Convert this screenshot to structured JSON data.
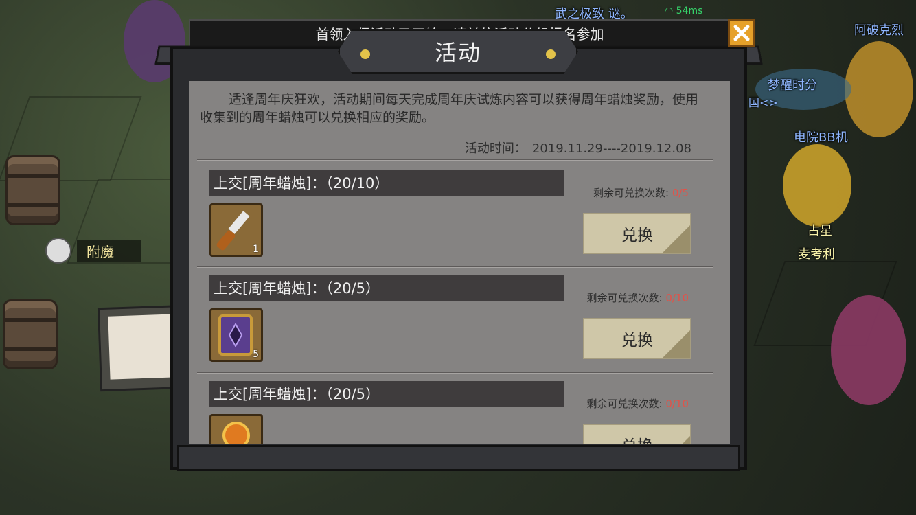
{
  "top_notice": "首领入侵活动已开始，请前往活动分组报名参加",
  "background_labels": {
    "top_center": "武之极致 谜。",
    "top_right": "阿破克烈",
    "right_1": "梦醒时分",
    "right_1_sub": "国<>",
    "right_2": "电院BB机",
    "right_3": "占星",
    "right_4": "麦考利"
  },
  "network": {
    "latency": "54ms"
  },
  "enchant_button": {
    "label": "附魔",
    "icon": "enchant-icon"
  },
  "dialog": {
    "title": "活动",
    "close_icon": "close-x-icon",
    "description": "适逢周年庆狂欢，活动期间每天完成周年庆试炼内容可以获得周年蜡烛奖励，使用收集到的周年蜡烛可以兑换相应的奖励。",
    "time_label": "活动时间：",
    "time_value": "2019.11.29----2019.12.08",
    "items": [
      {
        "header": "上交[周年蜡烛]：（20/10）",
        "remain_label": "剩余可兑换次数:",
        "remain_value": "0/5",
        "button": "兑换",
        "qty": "1",
        "icon": "chisel-icon"
      },
      {
        "header": "上交[周年蜡烛]：（20/5）",
        "remain_label": "剩余可兑换次数:",
        "remain_value": "0/10",
        "button": "兑换",
        "qty": "5",
        "icon": "spellbook-icon"
      },
      {
        "header": "上交[周年蜡烛]：（20/5）",
        "remain_label": "剩余可兑换次数:",
        "remain_value": "0/10",
        "button": "兑换",
        "qty": "",
        "icon": "orb-icon"
      }
    ]
  },
  "colors": {
    "accent_gold": "#e3c34a",
    "remain_red": "#e0534a",
    "close_orange": "#e6a12a"
  }
}
